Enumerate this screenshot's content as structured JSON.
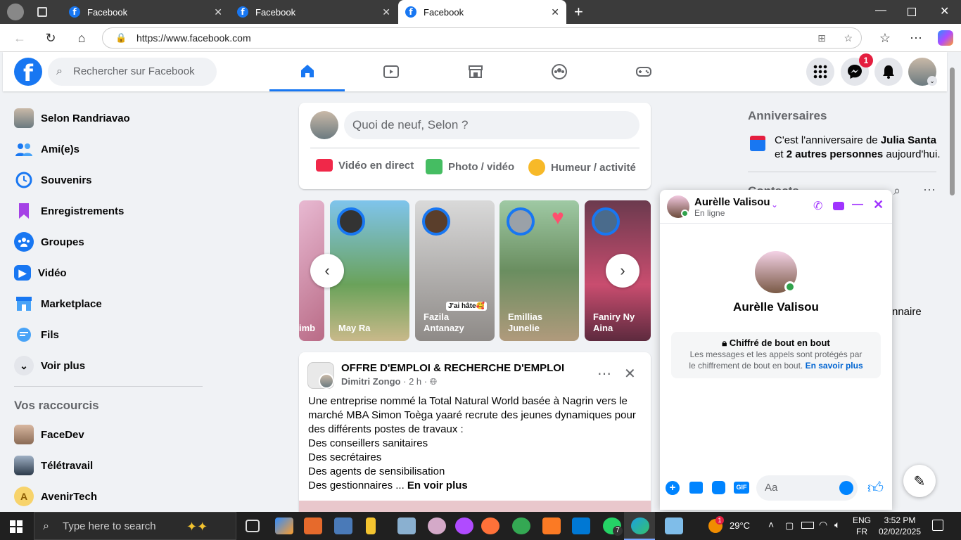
{
  "browser": {
    "tabs": [
      {
        "title": "Facebook"
      },
      {
        "title": "Facebook"
      },
      {
        "title": "Facebook"
      }
    ],
    "url": "https://www.facebook.com"
  },
  "header": {
    "search_placeholder": "Rechercher sur Facebook",
    "messenger_badge": "1"
  },
  "sidebar": {
    "profile_name": "Selon Randriavao",
    "items": [
      {
        "label": "Ami(e)s",
        "icon": "friends-icon"
      },
      {
        "label": "Souvenirs",
        "icon": "memories-icon"
      },
      {
        "label": "Enregistrements",
        "icon": "saved-icon"
      },
      {
        "label": "Groupes",
        "icon": "groups-icon"
      },
      {
        "label": "Vidéo",
        "icon": "video-icon"
      },
      {
        "label": "Marketplace",
        "icon": "marketplace-icon"
      },
      {
        "label": "Fils",
        "icon": "feeds-icon"
      },
      {
        "label": "Voir plus",
        "icon": "chevron-down-icon"
      }
    ],
    "shortcuts_title": "Vos raccourcis",
    "shortcuts": [
      {
        "label": "FaceDev"
      },
      {
        "label": "Télétravail"
      },
      {
        "label": "AvenirTech",
        "initial": "A"
      }
    ]
  },
  "composer": {
    "placeholder": "Quoi de neuf, Selon ?",
    "live": "Vidéo en direct",
    "photo": "Photo / vidéo",
    "mood": "Humeur / activité"
  },
  "stories": [
    {
      "name": "imb"
    },
    {
      "name": "May Ra"
    },
    {
      "name": "Fazila\nAntanazy",
      "sticker": "J'ai hâte🥰"
    },
    {
      "name": "Emillias\nJunelie"
    },
    {
      "name": "Faniry Ny Aina"
    }
  ],
  "post": {
    "group": "OFFRE D'EMPLOI & RECHERCHE D'EMPLOI",
    "author": "Dimitri Zongo",
    "time": "2 h",
    "lines": [
      "Une entreprise nommé la Total Natural World basée à Nagrin vers le",
      "marché MBA Simon Toèga yaaré recrute des jeunes dynamiques pour",
      "des différents postes de travaux :",
      "Des conseillers sanitaires",
      "Des secrétaires",
      "Des agents de sensibilisation"
    ],
    "last_line": "Des gestionnaires ...",
    "see_more": "En voir plus"
  },
  "right": {
    "birthdays_title": "Anniversaires",
    "birthday_pre": "C'est l'anniversaire de ",
    "birthday_name": "Julia Santa",
    "birthday_mid": "et ",
    "birthday_others": "2 autres personnes",
    "birthday_post": " aujourd'hui.",
    "contacts_title": "Contacts",
    "partial_text": "nnaire"
  },
  "chat": {
    "name": "Aurèlle Valisou",
    "status": "En ligne",
    "profile_name": "Aurèlle Valisou",
    "e2e_title": "Chiffré de bout en bout",
    "e2e_text1": "Les messages et les appels sont protégés par",
    "e2e_text2": "le chiffrement de bout en bout.",
    "e2e_link": "En savoir plus",
    "input_placeholder": "Aa"
  },
  "taskbar": {
    "search_placeholder": "Type here to search",
    "temp": "29°C",
    "lang1": "ENG",
    "lang2": "FR",
    "time": "3:52 PM",
    "date": "02/02/2025",
    "whatsapp_badge": "7",
    "weather_badge": "1"
  },
  "colors": {
    "fb_blue": "#1877f2",
    "messenger_purple": "#a033ff",
    "badge_red": "#e41e3f"
  }
}
